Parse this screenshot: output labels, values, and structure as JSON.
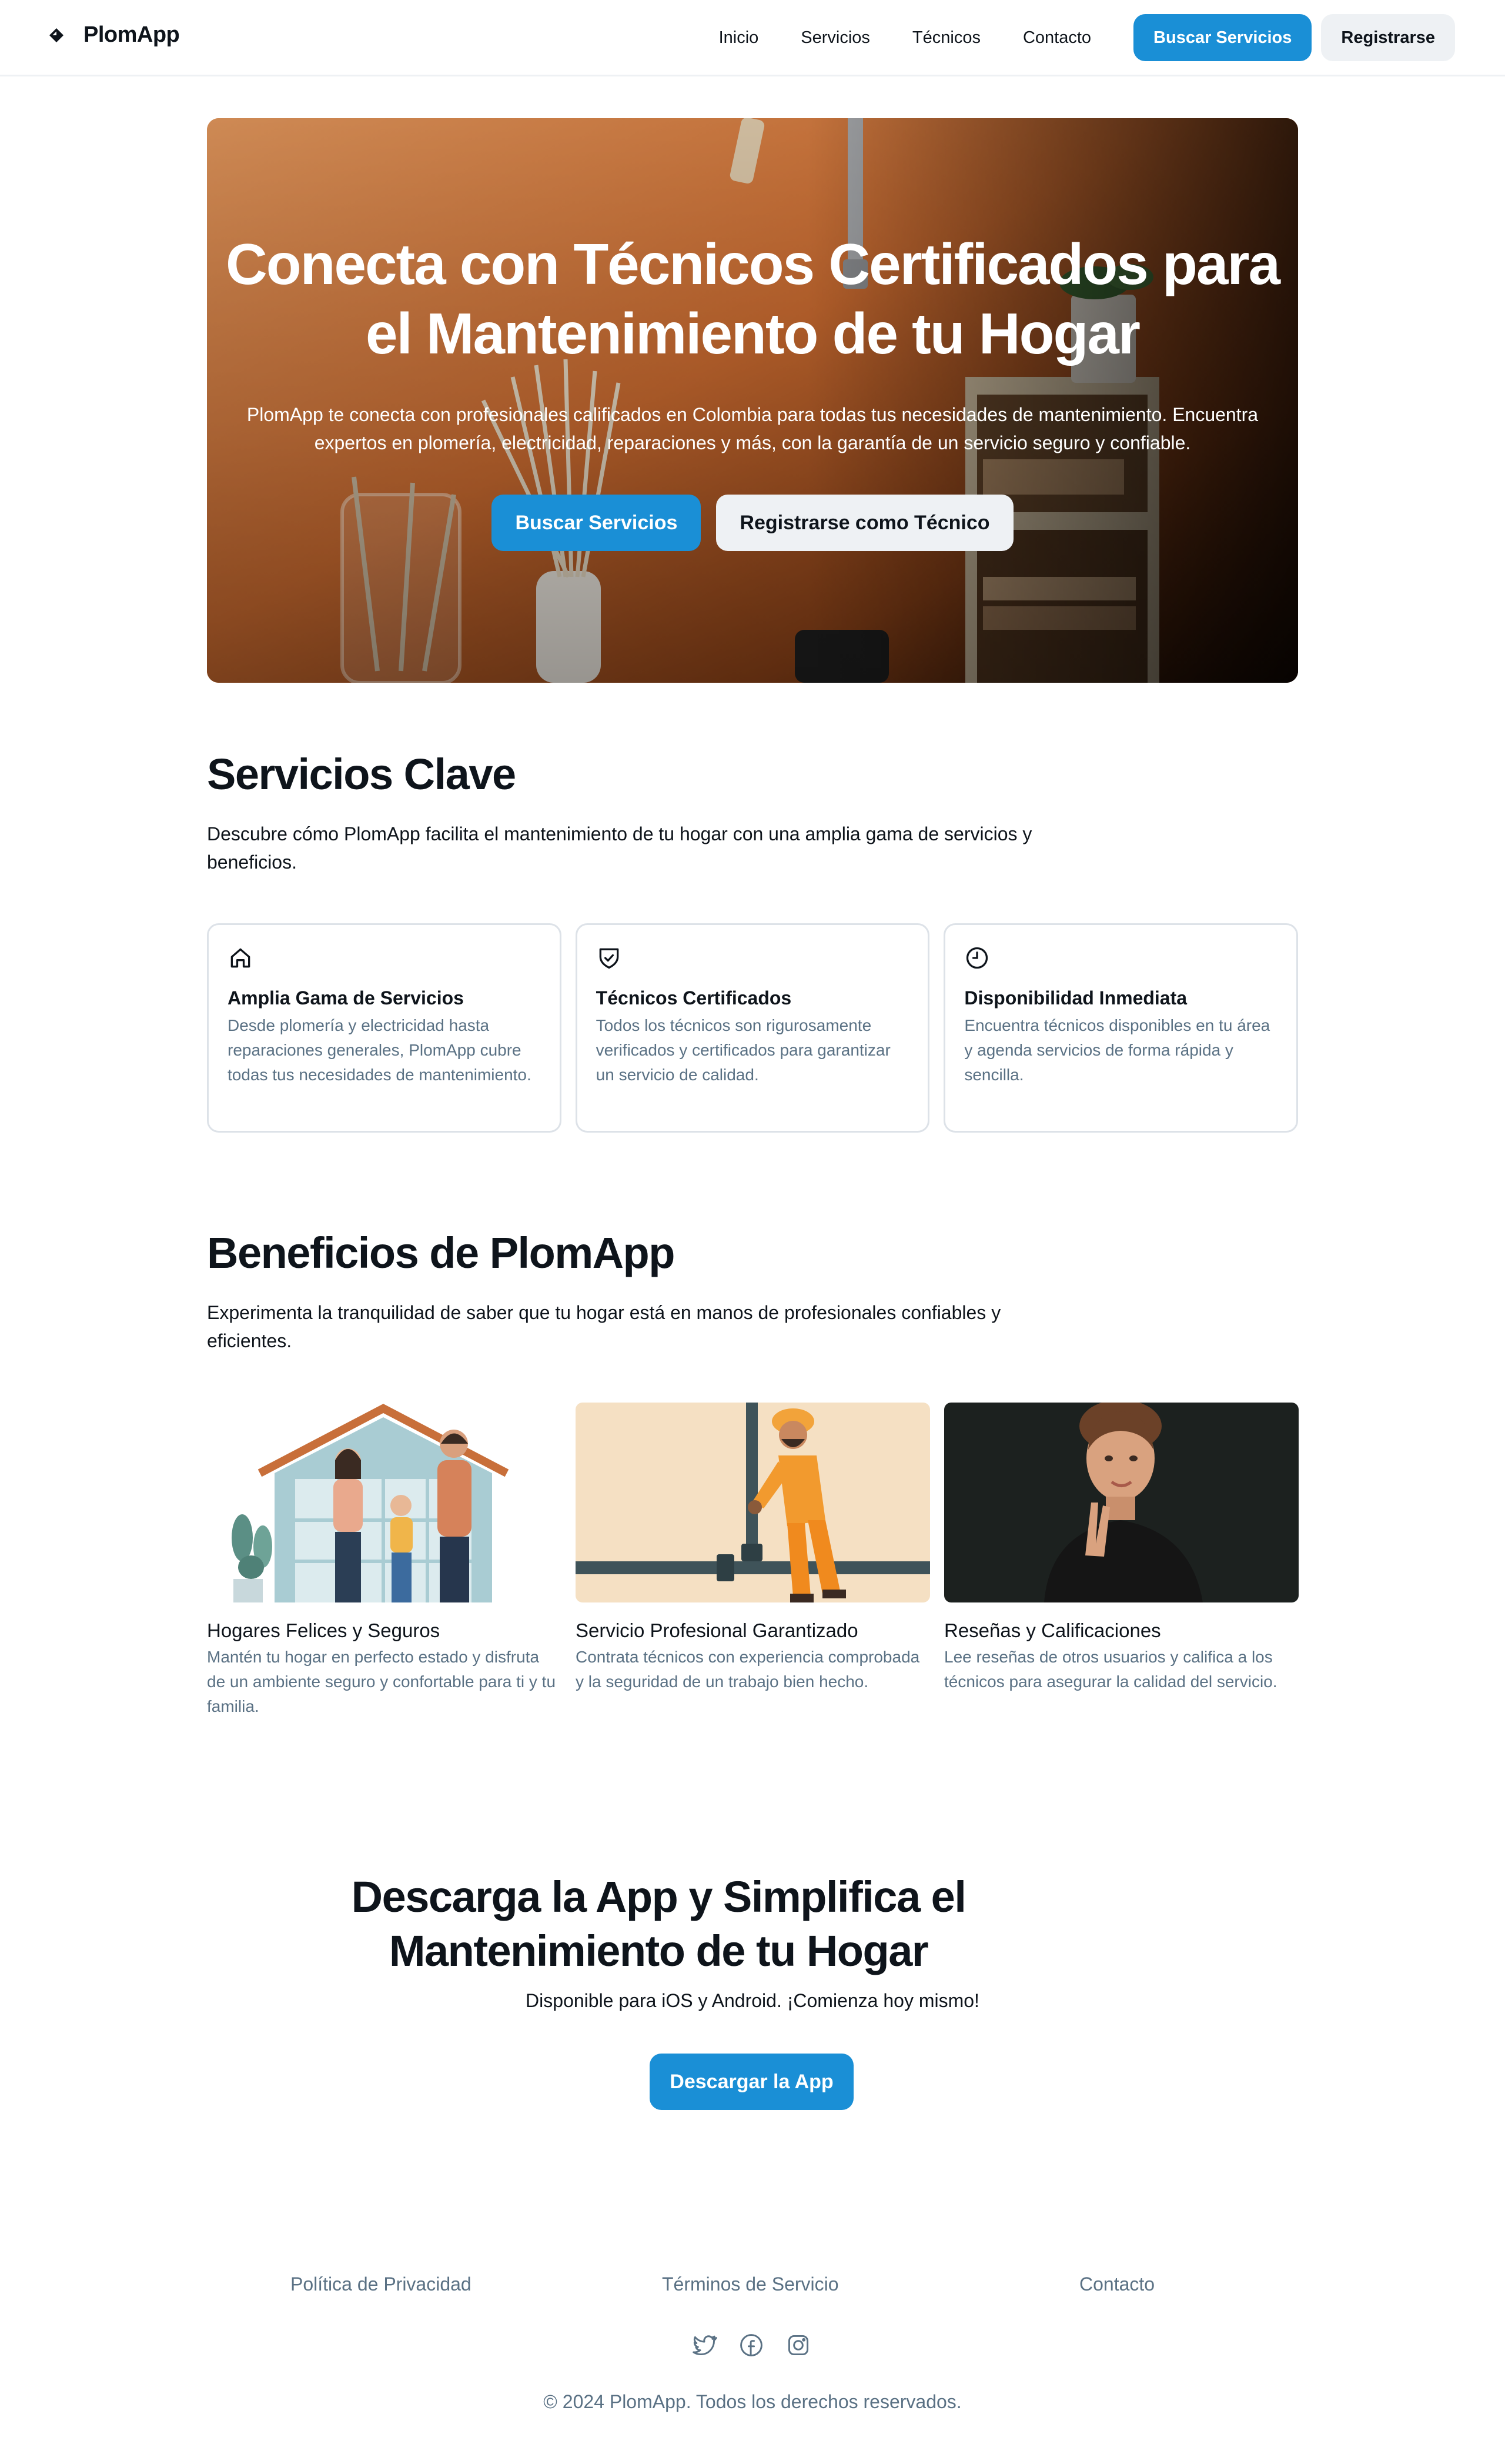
{
  "header": {
    "brand": "PlomApp",
    "nav": [
      "Inicio",
      "Servicios",
      "Técnicos",
      "Contacto"
    ],
    "search_button": "Buscar Servicios",
    "register_button": "Registrarse"
  },
  "hero": {
    "title": "Conecta con Técnicos Certificados para el Mantenimiento de tu Hogar",
    "subtitle": "PlomApp te conecta con profesionales calificados en Colombia para todas tus necesidades de mantenimiento. Encuentra expertos en plomería, electricidad, reparaciones y más, con la garantía de un servicio seguro y confiable.",
    "primary_button": "Buscar Servicios",
    "secondary_button": "Registrarse como Técnico"
  },
  "services": {
    "title": "Servicios Clave",
    "description": "Descubre cómo PlomApp facilita el mantenimiento de tu hogar con una amplia gama de servicios y beneficios.",
    "cards": [
      {
        "icon": "house-icon",
        "title": "Amplia Gama de Servicios",
        "text": "Desde plomería y electricidad hasta reparaciones generales, PlomApp cubre todas tus necesidades de mantenimiento."
      },
      {
        "icon": "shield-check-icon",
        "title": "Técnicos Certificados",
        "text": "Todos los técnicos son rigurosamente verificados y certificados para garantizar un servicio de calidad."
      },
      {
        "icon": "clock-icon",
        "title": "Disponibilidad Inmediata",
        "text": "Encuentra técnicos disponibles en tu área y agenda servicios de forma rápida y sencilla."
      }
    ]
  },
  "benefits": {
    "title": "Beneficios de PlomApp",
    "description": "Experimenta la tranquilidad de saber que tu hogar está en manos de profesionales confiables y eficientes.",
    "items": [
      {
        "title": "Hogares Felices y Seguros",
        "text": "Mantén tu hogar en perfecto estado y disfruta de un ambiente seguro y confortable para ti y tu familia."
      },
      {
        "title": "Servicio Profesional Garantizado",
        "text": "Contrata técnicos con experiencia comprobada y la seguridad de un trabajo bien hecho."
      },
      {
        "title": "Reseñas y Calificaciones",
        "text": "Lee reseñas de otros usuarios y califica a los técnicos para asegurar la calidad del servicio."
      }
    ]
  },
  "cta": {
    "title": "Descarga la App y Simplifica el Mantenimiento de tu Hogar",
    "subtitle": "Disponible para iOS y Android. ¡Comienza hoy mismo!",
    "button": "Descargar la App"
  },
  "footer": {
    "links": [
      "Política de Privacidad",
      "Términos de Servicio",
      "Contacto"
    ],
    "socials": [
      "twitter-icon",
      "facebook-icon",
      "instagram-icon"
    ],
    "copyright": "© 2024 PlomApp. Todos los derechos reservados."
  },
  "colors": {
    "primary": "#1a8fd6",
    "light_button": "#eef1f4",
    "muted_text": "#5a7184",
    "text": "#0e141b"
  }
}
